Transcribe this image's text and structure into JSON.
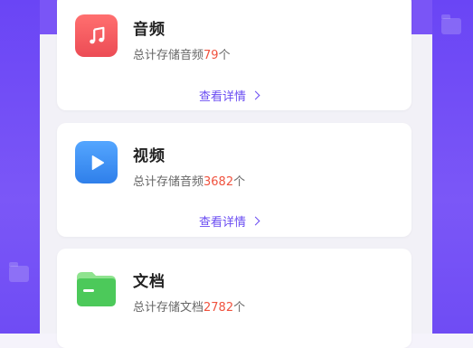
{
  "colors": {
    "accent": "#6a4cf2",
    "count": "#f0523e",
    "audio_icon": "#f45a5a",
    "video_icon": "#3a8cf2",
    "doc_icon": "#4fd060"
  },
  "cards": [
    {
      "icon": "music-note-icon",
      "title": "音频",
      "desc_prefix": "总计存储音频",
      "count": "79",
      "desc_suffix": "个",
      "link": "查看详情"
    },
    {
      "icon": "play-icon",
      "title": "视频",
      "desc_prefix": "总计存储音频",
      "count": "3682",
      "desc_suffix": "个",
      "link": "查看详情"
    },
    {
      "icon": "folder-icon",
      "title": "文档",
      "desc_prefix": "总计存储文档",
      "count": "2782",
      "desc_suffix": "个"
    }
  ]
}
